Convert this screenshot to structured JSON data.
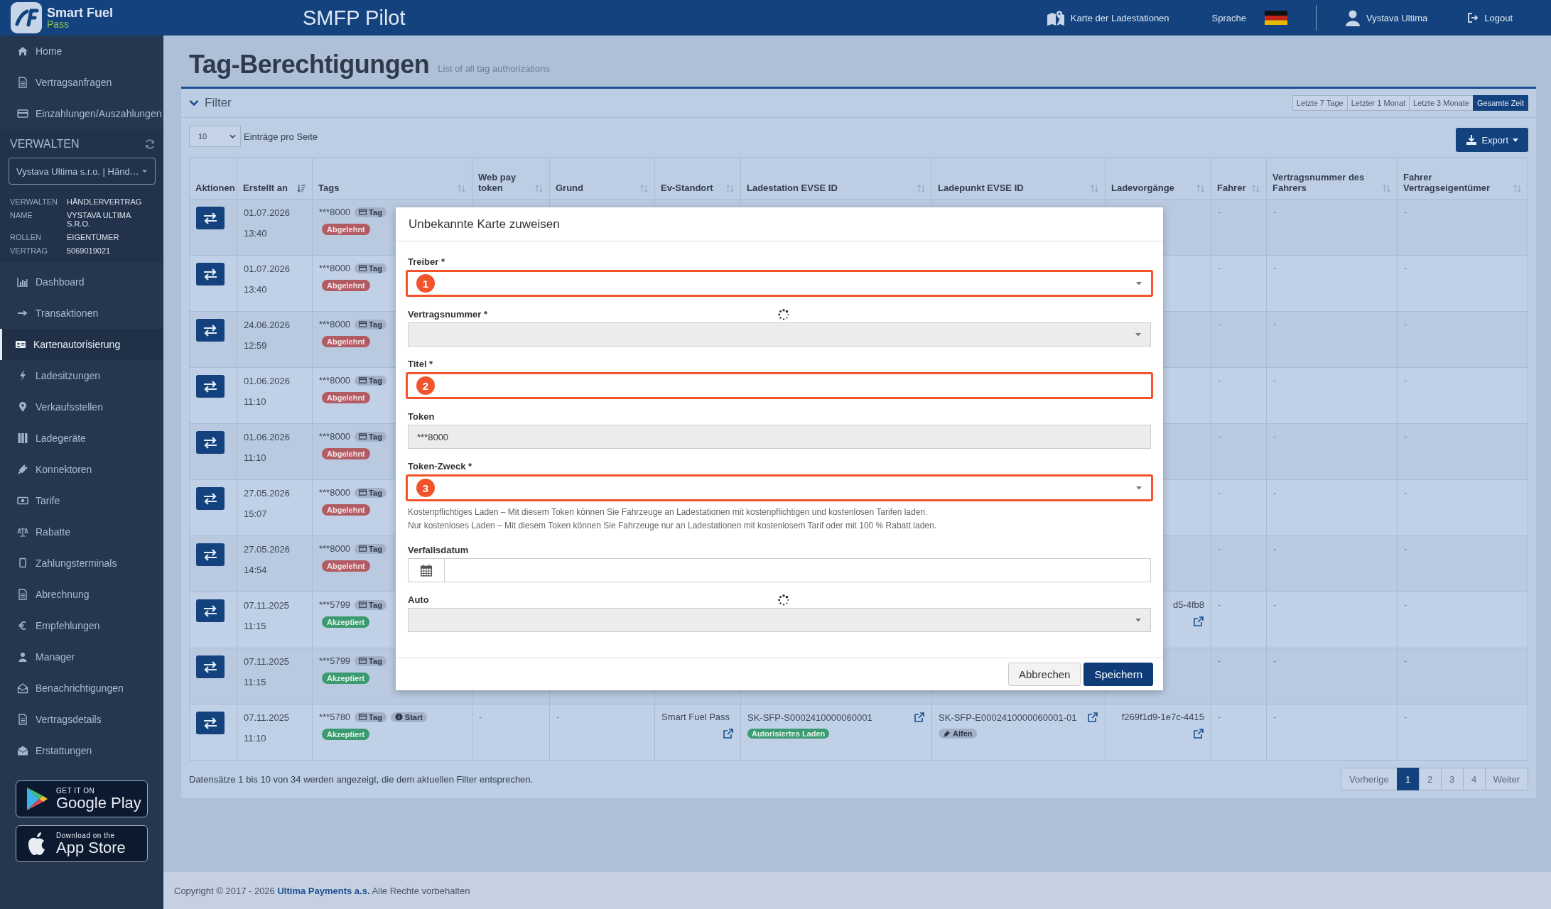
{
  "header": {
    "logo": {
      "name": "Smart Fuel",
      "sub": "Pass"
    },
    "app_title": "SMFP Pilot",
    "map_link": "Karte der Ladestationen",
    "language_label": "Sprache",
    "user": "Vystava Ultima",
    "logout": "Logout"
  },
  "sidebar": {
    "top_items": [
      {
        "label": "Home",
        "selected": false
      },
      {
        "label": "Vertragsanfragen",
        "selected": false
      },
      {
        "label": "Einzahlungen/Auszahlungen",
        "selected": false
      }
    ],
    "section_title": "VERWALTEN",
    "contract_select": "Vystava Ultima s.r.o. | Händ…",
    "info": [
      {
        "label": "VERWALTEN",
        "value": "HÄNDLERVERTRAG"
      },
      {
        "label": "NAME",
        "value": "VYSTAVA ULTIMA S.R.O."
      },
      {
        "label": "ROLLEN",
        "value": "EIGENTÜMER"
      },
      {
        "label": "VERTRAG",
        "value": "5069019021"
      }
    ],
    "items": [
      {
        "label": "Dashboard",
        "selected": false
      },
      {
        "label": "Transaktionen",
        "selected": false
      },
      {
        "label": "Kartenautorisierung",
        "selected": true
      },
      {
        "label": "Ladesitzungen",
        "selected": false
      },
      {
        "label": "Verkaufsstellen",
        "selected": false
      },
      {
        "label": "Ladegeräte",
        "selected": false
      },
      {
        "label": "Konnektoren",
        "selected": false
      },
      {
        "label": "Tarife",
        "selected": false
      },
      {
        "label": "Rabatte",
        "selected": false
      },
      {
        "label": "Zahlungsterminals",
        "selected": false
      },
      {
        "label": "Abrechnung",
        "selected": false
      },
      {
        "label": "Empfehlungen",
        "selected": false
      },
      {
        "label": "Manager",
        "selected": false
      },
      {
        "label": "Benachrichtigungen",
        "selected": false
      },
      {
        "label": "Vertragsdetails",
        "selected": false
      },
      {
        "label": "Erstattungen",
        "selected": false
      }
    ],
    "stores": [
      {
        "kind": "google",
        "small": "GET IT ON",
        "big": "Google Play"
      },
      {
        "kind": "apple",
        "small": "Download on the",
        "big": "App Store"
      }
    ]
  },
  "page": {
    "title": "Tag-Berechtigungen",
    "subtitle": "List of all tag authorizations"
  },
  "filter": {
    "label": "Filter",
    "expanded": true,
    "ranges": [
      {
        "label": "Letzte 7 Tage",
        "selected": false
      },
      {
        "label": "Letzter 1 Monat",
        "selected": false
      },
      {
        "label": "Letzte 3 Monate",
        "selected": false
      },
      {
        "label": "Gesamte Zeit",
        "selected": true
      }
    ]
  },
  "page_size": {
    "value": "10",
    "label": "Einträge pro Seite"
  },
  "export": "Export",
  "table": {
    "columns": [
      {
        "label": "Aktionen"
      },
      {
        "label": "Erstellt an",
        "sorted": true
      },
      {
        "label": "Tags",
        "sorted": false
      },
      {
        "label": "Web pay token",
        "sorted": false
      },
      {
        "label": "Grund",
        "sorted": false
      },
      {
        "label": "Ev-Standort",
        "sorted": false
      },
      {
        "label": "Ladestation EVSE ID",
        "sorted": false
      },
      {
        "label": "Ladepunkt EVSE ID",
        "sorted": false
      },
      {
        "label": "Ladevorgänge",
        "sorted": false
      },
      {
        "label": "Fahrer",
        "sorted": false
      },
      {
        "label": "Vertragsnummer des Fahrers",
        "sorted": false
      },
      {
        "label": "Fahrer Vertragseigentümer",
        "sorted": false
      }
    ],
    "rows": [
      {
        "date": "01.07.2026",
        "time": "13:40",
        "tags": {
          "token": "***8000",
          "type": "Tag",
          "status": {
            "label": "Abgelehnt",
            "kind": "rejected"
          }
        },
        "fahrer": {
          "text": "-"
        },
        "vertragsnummer": {
          "text": "-"
        },
        "eigentuemer": {
          "text": "-"
        }
      },
      {
        "date": "01.07.2026",
        "time": "13:40",
        "tags": {
          "token": "***8000",
          "type": "Tag",
          "status": {
            "label": "Abgelehnt",
            "kind": "rejected"
          }
        },
        "fahrer": {
          "text": "-"
        },
        "vertragsnummer": {
          "text": "-"
        },
        "eigentuemer": {
          "text": "-"
        }
      },
      {
        "date": "24.06.2026",
        "time": "12:59",
        "tags": {
          "token": "***8000",
          "type": "Tag",
          "status": {
            "label": "Abgelehnt",
            "kind": "rejected"
          }
        },
        "fahrer": {
          "text": "-"
        },
        "vertragsnummer": {
          "text": "-"
        },
        "eigentuemer": {
          "text": "-"
        }
      },
      {
        "date": "01.06.2026",
        "time": "11:10",
        "tags": {
          "token": "***8000",
          "type": "Tag",
          "status": {
            "label": "Abgelehnt",
            "kind": "rejected"
          }
        },
        "fahrer": {
          "text": "-"
        },
        "vertragsnummer": {
          "text": "-"
        },
        "eigentuemer": {
          "text": "-"
        }
      },
      {
        "date": "01.06.2026",
        "time": "11:10",
        "tags": {
          "token": "***8000",
          "type": "Tag",
          "status": {
            "label": "Abgelehnt",
            "kind": "rejected"
          }
        },
        "fahrer": {
          "text": "-"
        },
        "vertragsnummer": {
          "text": "-"
        },
        "eigentuemer": {
          "text": "-"
        }
      },
      {
        "date": "27.05.2026",
        "time": "15:07",
        "tags": {
          "token": "***8000",
          "type": "Tag",
          "status": {
            "label": "Abgelehnt",
            "kind": "rejected"
          }
        },
        "fahrer": {
          "text": "-"
        },
        "vertragsnummer": {
          "text": "-"
        },
        "eigentuemer": {
          "text": "-"
        }
      },
      {
        "date": "27.05.2026",
        "time": "14:54",
        "tags": {
          "token": "***8000",
          "type": "Tag",
          "status": {
            "label": "Abgelehnt",
            "kind": "rejected"
          }
        },
        "fahrer": {
          "text": "-"
        },
        "vertragsnummer": {
          "text": "-"
        },
        "eigentuemer": {
          "text": "-"
        }
      },
      {
        "date": "07.11.2025",
        "time": "11:15",
        "tags": {
          "token": "***5799",
          "type": "Tag",
          "status": {
            "label": "Akzeptiert",
            "kind": "accepted"
          }
        },
        "ladevorgang": {
          "text": "d5-4fb8",
          "link": true
        },
        "fahrer": {
          "text": "-"
        },
        "vertragsnummer": {
          "text": "-"
        },
        "eigentuemer": {
          "text": "-"
        }
      },
      {
        "date": "07.11.2025",
        "time": "11:15",
        "tags": {
          "token": "***5799",
          "type": "Tag",
          "status": {
            "label": "Akzeptiert",
            "kind": "accepted"
          }
        },
        "fahrer": {
          "text": "-"
        },
        "vertragsnummer": {
          "text": "-"
        },
        "eigentuemer": {
          "text": "-"
        }
      },
      {
        "date": "07.11.2025",
        "time": "11:10",
        "tags": {
          "token": "***5780",
          "type": "Tag",
          "extra": "Start",
          "status": {
            "label": "Akzeptiert",
            "kind": "accepted"
          }
        },
        "web_pay_token": {
          "text": "-"
        },
        "grund": {
          "text": "-"
        },
        "ev_standort": {
          "text": "Smart Fuel Pass",
          "link": true
        },
        "ladestation": {
          "text": "SK-SFP-S0002410000060001",
          "link": true,
          "badge": {
            "label": "Autorisiertes Laden",
            "kind": "authorized"
          }
        },
        "ladepunkt": {
          "text": "SK-SFP-E0002410000060001-01",
          "link": true,
          "badge": {
            "label": "Alfen",
            "kind": "vendor"
          }
        },
        "ladevorgang": {
          "text": "f269f1d9-1e7c-4415",
          "link": true
        },
        "fahrer": {
          "text": "-"
        },
        "vertragsnummer": {
          "text": "-"
        },
        "eigentuemer": {
          "text": "-"
        }
      }
    ]
  },
  "summary": "Datensätze 1 bis 10 von 34 werden angezeigt, die dem aktuellen Filter entsprechen.",
  "pagination": {
    "previous": "Vorherige",
    "pages": [
      {
        "label": "1",
        "selected": true
      },
      {
        "label": "2",
        "selected": false
      },
      {
        "label": "3",
        "selected": false
      },
      {
        "label": "4",
        "selected": false
      }
    ],
    "next": "Weiter"
  },
  "footer": "Copyright © 2017 - 2026 **Ultima Payments a.s.** Alle Rechte vorbehalten",
  "modal": {
    "title": "Unbekannte Karte zuweisen",
    "fields": [
      {
        "kind": "select",
        "label": "Treiber *",
        "marker": "1"
      },
      {
        "kind": "select",
        "label": "Vertragsnummer *",
        "disabled": true,
        "loading": true
      },
      {
        "kind": "text",
        "label": "Titel *",
        "marker": "2"
      },
      {
        "kind": "text",
        "label": "Token",
        "value": "***8000",
        "disabled": true
      },
      {
        "kind": "select",
        "label": "Token-Zweck *",
        "marker": "3",
        "help": [
          "Kostenpflichtiges Laden – Mit diesem Token können Sie Fahrzeuge an Ladestationen mit kostenpflichtigen und kostenlosen Tarifen laden.",
          "Nur kostenloses Laden – Mit diesem Token können Sie Fahrzeuge nur an Ladestationen mit kostenlosem Tarif oder mit 100 % Rabatt laden."
        ]
      },
      {
        "kind": "date",
        "label": "Verfallsdatum"
      },
      {
        "kind": "select",
        "label": "Auto",
        "disabled": true,
        "loading": true
      }
    ],
    "buttons": [
      {
        "label": "Abbrechen",
        "kind": "secondary"
      },
      {
        "label": "Speichern",
        "kind": "primary"
      }
    ]
  }
}
